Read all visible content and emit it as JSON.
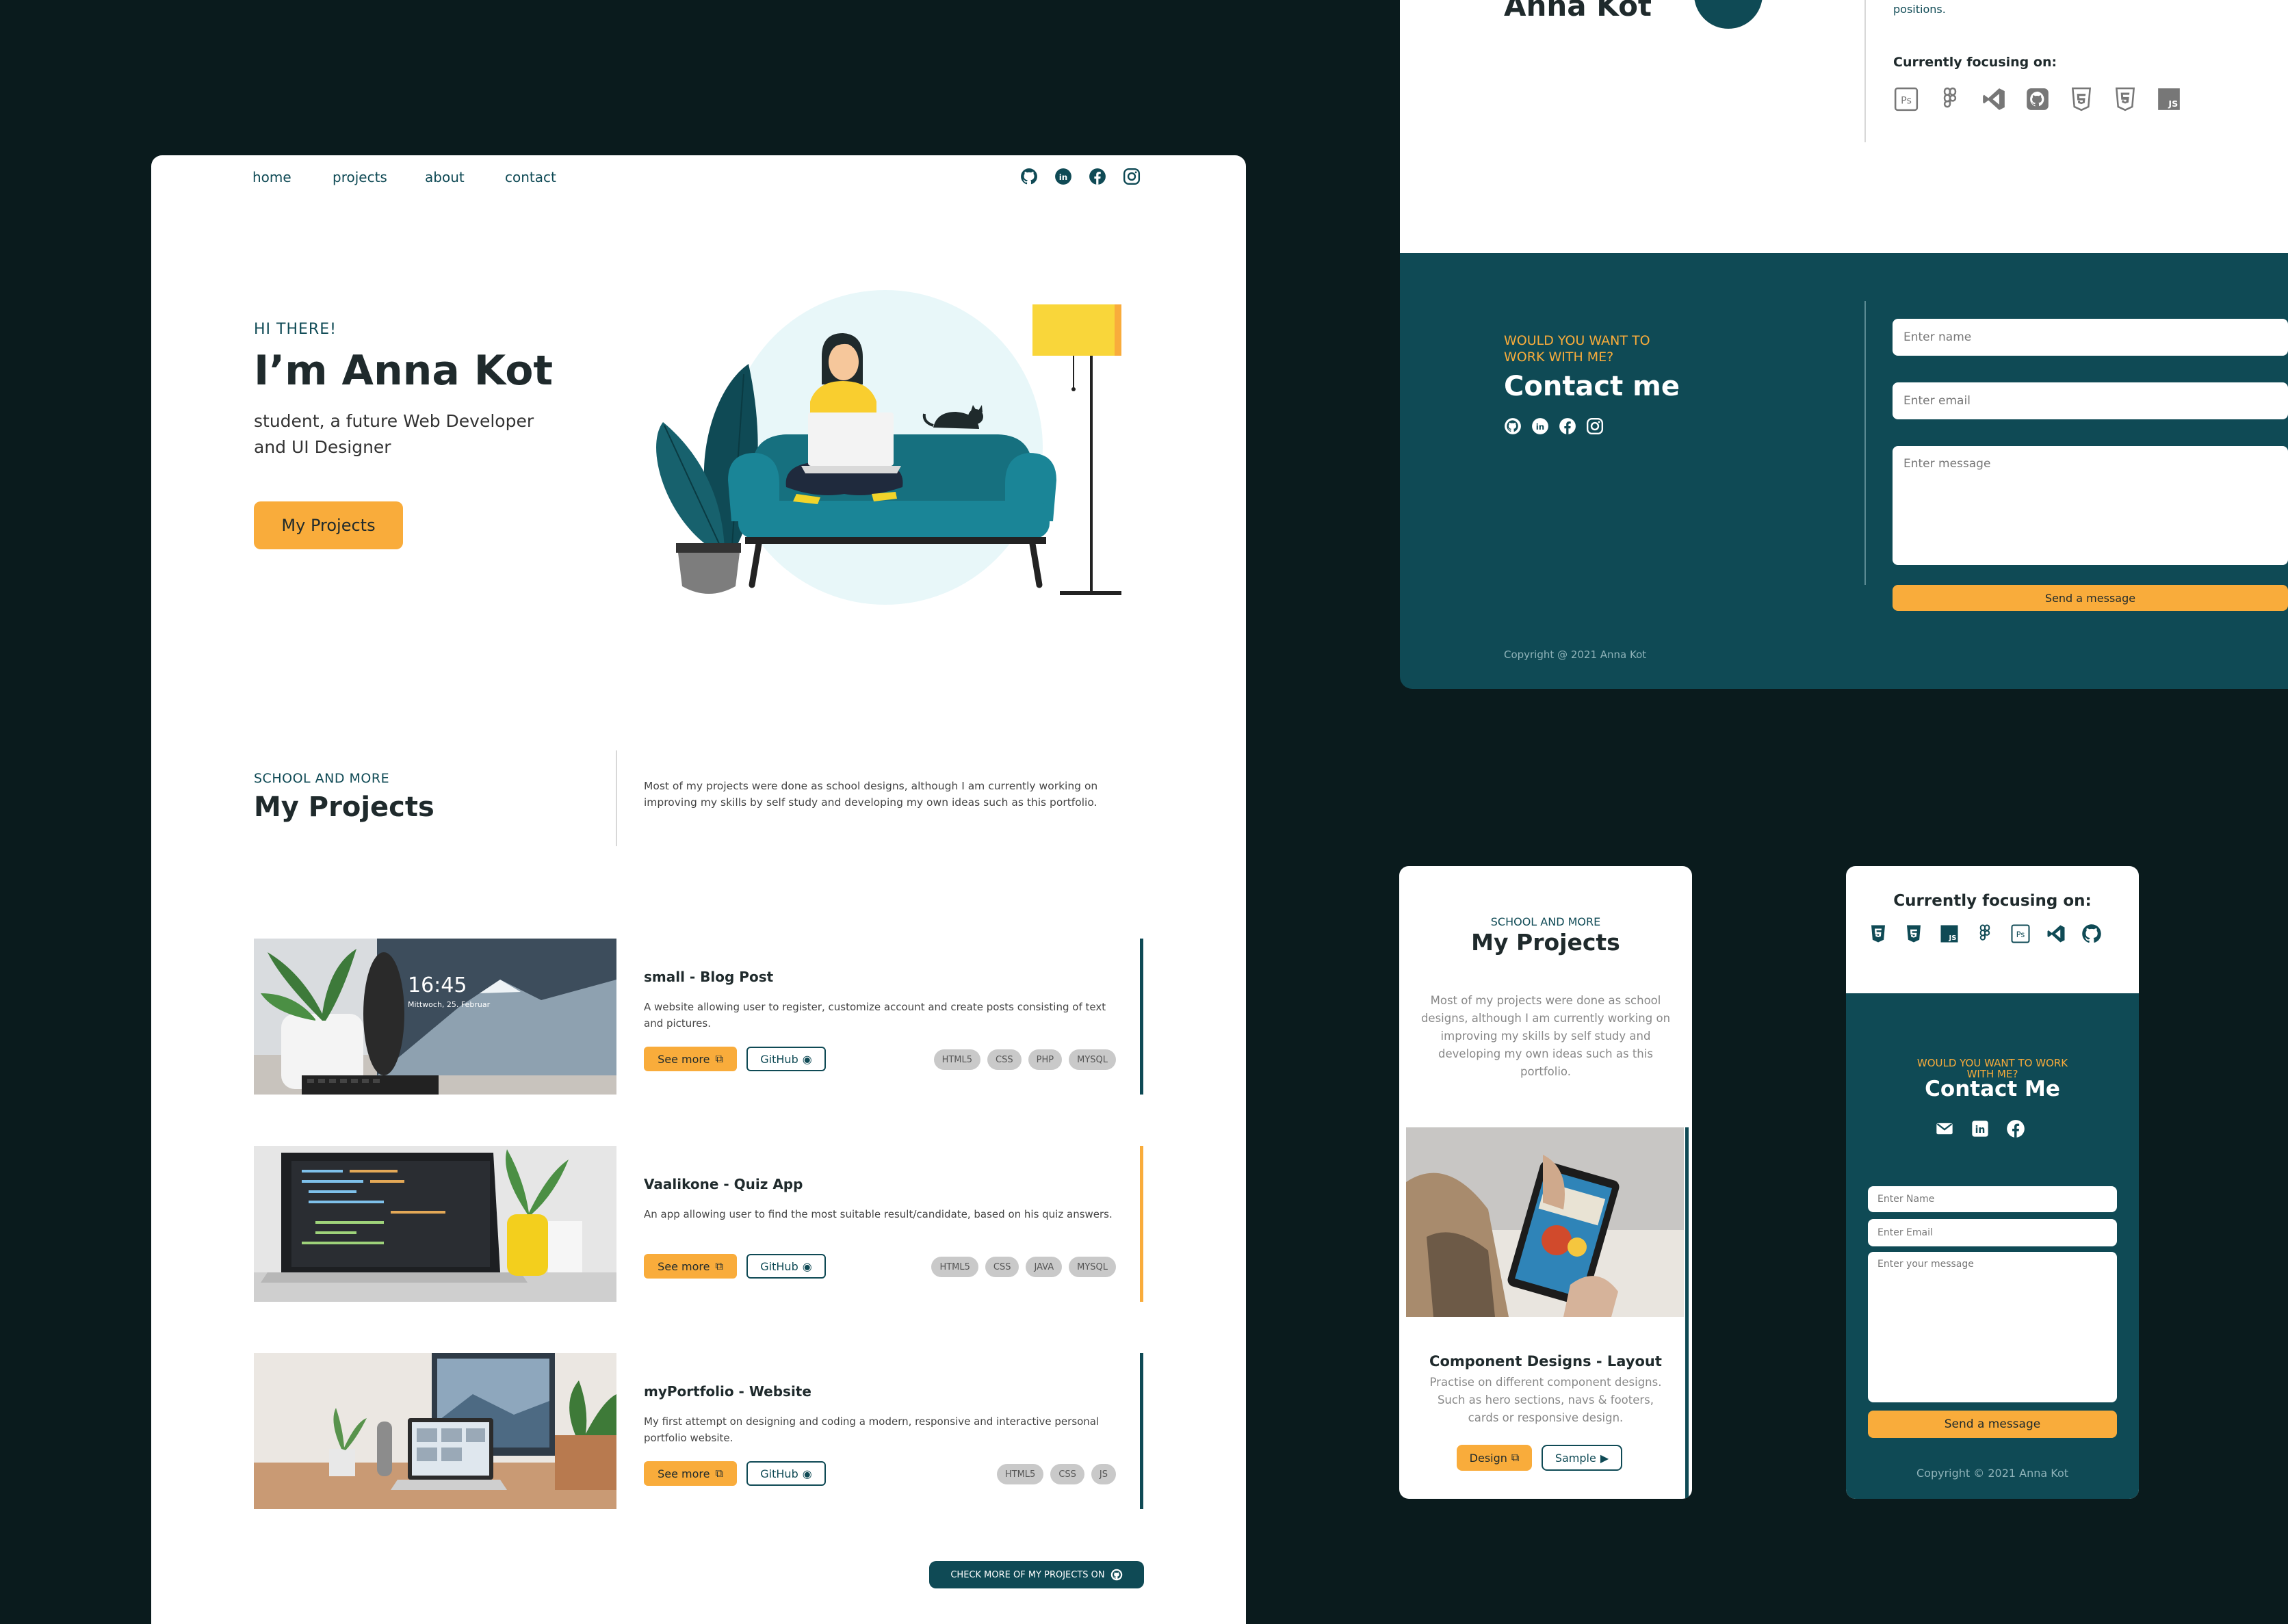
{
  "desktop": {
    "nav": {
      "home": "home",
      "projects": "projects",
      "about": "about",
      "contact": "contact"
    },
    "hero": {
      "eyebrow": "HI THERE!",
      "title": "I’m Anna Kot",
      "subtitle": "student, a future Web Developer and UI Designer",
      "button": "My Projects"
    },
    "projects_section": {
      "eyebrow": "SCHOOL AND MORE",
      "title": "My Projects",
      "description": "Most of my projects were done as school designs, although I am currently working on improving my skills by self study and developing my own ideas such as this portfolio."
    },
    "projects": [
      {
        "title": "small - Blog Post",
        "description": "A website allowing user to register, customize account and create posts consisting of text and pictures.",
        "see_more": "See more",
        "github": "GitHub",
        "tags": [
          "HTML5",
          "CSS",
          "PHP",
          "MYSQL"
        ],
        "bar_color": "#0f4a55",
        "monitor_time": "16:45",
        "monitor_date": "Mittwoch, 25. Februar"
      },
      {
        "title": "Vaalikone - Quiz App",
        "description": "An app allowing user to find the most suitable result/candidate, based on his quiz answers.",
        "see_more": "See more",
        "github": "GitHub",
        "tags": [
          "HTML5",
          "CSS",
          "JAVA",
          "MYSQL"
        ],
        "bar_color": "#f9ac3b"
      },
      {
        "title": "myPortfolio - Website",
        "description": "My first attempt on designing and coding a modern, responsive and interactive personal portfolio website.",
        "see_more": "See more",
        "github": "GitHub",
        "tags": [
          "HTML5",
          "CSS",
          "JS"
        ],
        "bar_color": "#0f4a55"
      }
    ],
    "check_more": "CHECK MORE OF MY PROJECTS ON"
  },
  "about_top": {
    "name": "Anna Kot",
    "positions_text": "positions.",
    "focusing_title": "Currently focusing on:",
    "focus_icons": [
      "photoshop-icon",
      "figma-icon",
      "vscode-icon",
      "github-icon",
      "css3-icon",
      "html5-icon",
      "js-icon"
    ]
  },
  "contact_desktop": {
    "eyebrow": "WOULD YOU WANT TO WORK WITH ME?",
    "title": "Contact me",
    "name_placeholder": "Enter name",
    "email_placeholder": "Enter email",
    "message_placeholder": "Enter message",
    "send": "Send a message",
    "copyright": "Copyright @ 2021 Anna Kot"
  },
  "mobile_projects": {
    "eyebrow": "SCHOOL AND MORE",
    "title": "My Projects",
    "description": "Most of my projects were done as school designs, although I am currently working on improving my skills by self study and developing my own ideas such as this portfolio.",
    "project_title": "Component Designs - Layout",
    "project_desc": "Practise on different component designs. Such as hero sections, navs & footers, cards or responsive design.",
    "design_btn": "Design",
    "sample_btn": "Sample"
  },
  "mobile_contact": {
    "focusing_title": "Currently focusing on:",
    "eyebrow": "WOULD YOU WANT TO WORK WITH ME?",
    "title": "Contact Me",
    "name_placeholder": "Enter Name",
    "email_placeholder": "Enter Email",
    "message_placeholder": "Enter your message",
    "send": "Send a message",
    "copyright": "Copyright © 2021 Anna Kot"
  },
  "colors": {
    "teal": "#0f4a55",
    "orange": "#f9ac3b",
    "dark_bg": "#0a1b1d"
  }
}
